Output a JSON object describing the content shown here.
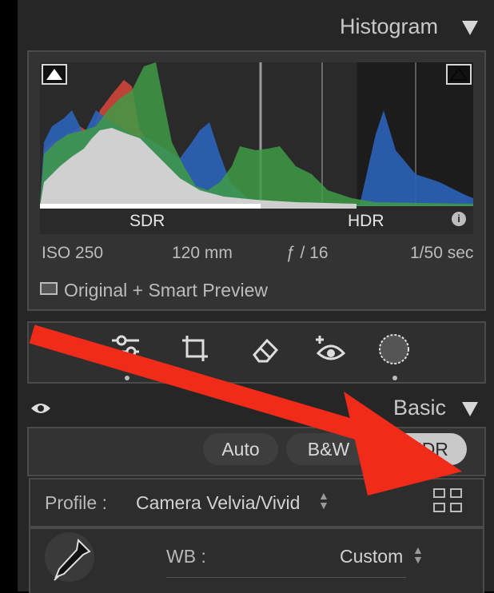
{
  "histogram": {
    "title": "Histogram",
    "sdr_label": "SDR",
    "hdr_label": "HDR",
    "info_icon": "info-icon",
    "iso": "ISO 250",
    "focal": "120 mm",
    "aperture": "ƒ / 16",
    "shutter": "1/50 sec",
    "preview_label": "Original + Smart Preview",
    "colors": {
      "red": "#d9463c",
      "green": "#3f9a45",
      "blue": "#2b63b8",
      "gray": "#d0d0d0"
    }
  },
  "tools": [
    "sliders-icon",
    "crop-icon",
    "eraser-icon",
    "redeye-icon",
    "mask-icon"
  ],
  "basic": {
    "title": "Basic",
    "auto_label": "Auto",
    "bw_label": "B&W",
    "hdr_label": "HDR",
    "profile_label": "Profile :",
    "profile_value": "Camera Velvia/Vivid",
    "wb_label": "WB :",
    "wb_value": "Custom"
  },
  "annotation": {
    "arrow_color": "#f02b1a"
  }
}
